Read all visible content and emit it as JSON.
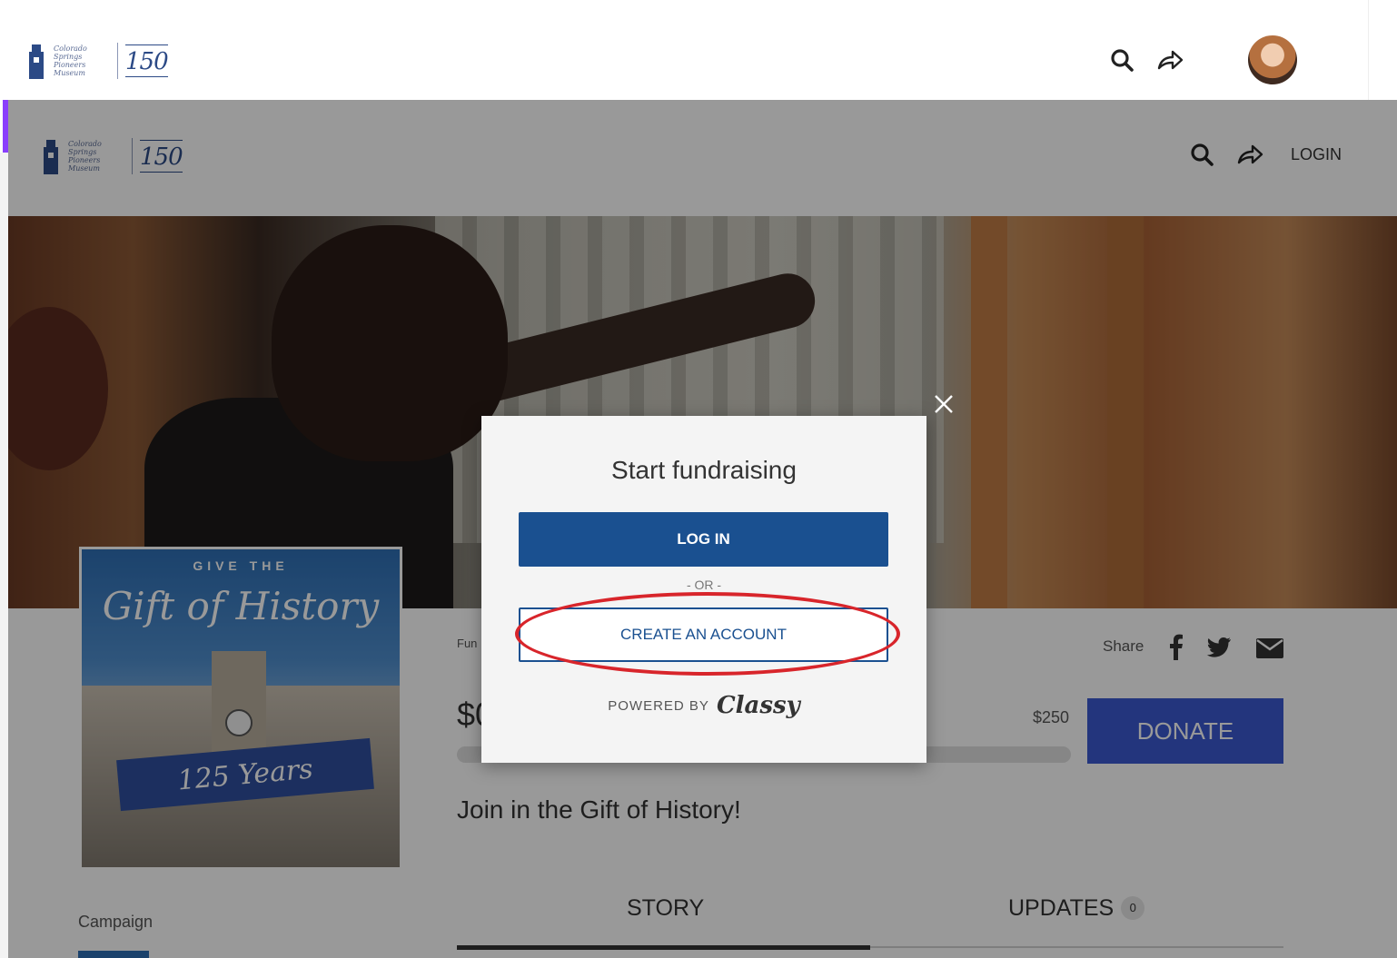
{
  "outer_header": {
    "logo": {
      "script_text": "Colorado Springs Pioneers Museum",
      "number": "150"
    }
  },
  "page_header": {
    "logo": {
      "script_text": "Colorado Springs Pioneers Museum",
      "number": "150"
    },
    "login_label": "LOGIN"
  },
  "campaign_cover": {
    "line1": "GIVE THE",
    "line2": "Gift of History",
    "ribbon": "125 Years"
  },
  "fundraiser": {
    "fund_label": "Fun",
    "share_label": "Share",
    "amount_raised": "$0",
    "goal": "$250",
    "donate_label": "DONATE",
    "headline": "Join in the Gift of History!",
    "campaign_label": "Campaign"
  },
  "tabs": [
    {
      "label": "STORY",
      "active": true
    },
    {
      "label": "UPDATES",
      "count": "0",
      "active": false
    }
  ],
  "modal": {
    "title": "Start fundraising",
    "login_button": "LOG IN",
    "or_text": "- OR -",
    "create_account_button": "CREATE AN ACCOUNT",
    "powered_by": "POWERED BY",
    "brand": "Classy"
  },
  "colors": {
    "primary_blue": "#1a5090",
    "donate_blue": "#3b59d1",
    "annotation_red": "#d8252b",
    "accent_purple": "#8a3ffc"
  },
  "icons": [
    "search-icon",
    "share-icon",
    "close-icon",
    "facebook-icon",
    "twitter-icon",
    "email-icon"
  ]
}
